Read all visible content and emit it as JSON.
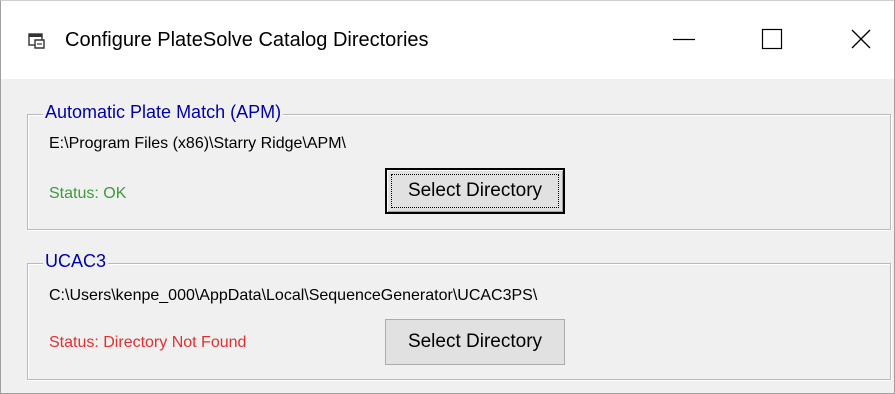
{
  "window": {
    "title": "Configure PlateSolve Catalog Directories",
    "icon": "app-window-icon",
    "controls": {
      "minimize_icon": "minimize-icon",
      "maximize_icon": "maximize-icon",
      "close_icon": "close-icon"
    }
  },
  "groups": [
    {
      "legend": "Automatic Plate Match (APM)",
      "path": "E:\\Program Files (x86)\\Starry Ridge\\APM\\",
      "status": "Status: OK",
      "status_color": "#3c9a3c",
      "button_label": "Select Directory",
      "button_focused": true
    },
    {
      "legend": "UCAC3",
      "path": "C:\\Users\\kenpe_000\\AppData\\Local\\SequenceGenerator\\UCAC3PS\\",
      "status": "Status: Directory Not Found",
      "status_color": "#e03030",
      "button_label": "Select Directory",
      "button_focused": false
    }
  ],
  "colors": {
    "legend_text": "#0000aa",
    "window_bg": "#f0f0f0",
    "titlebar_bg": "#ffffff"
  }
}
